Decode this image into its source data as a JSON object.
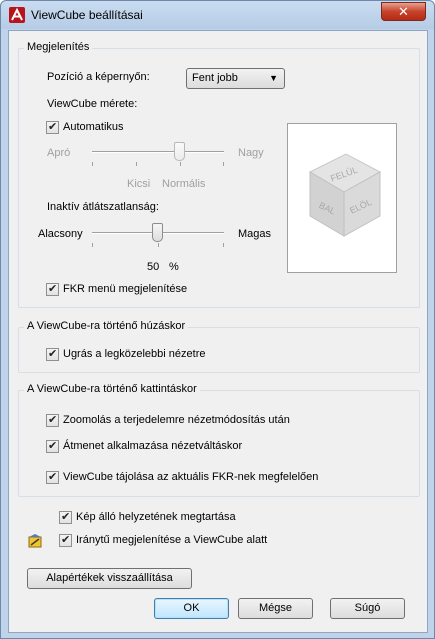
{
  "window": {
    "title": "ViewCube beállításai",
    "close_glyph": "✕"
  },
  "display": {
    "group_title": "Megjelenítés",
    "position_label": "Pozíció a képernyőn:",
    "position_value": "Fent jobb",
    "size_label": "ViewCube mérete:",
    "auto_label": "Automatikus",
    "auto_checked": true,
    "size_min_label": "Apró",
    "size_max_label": "Nagy",
    "size_tick_small": "Kicsi",
    "size_tick_normal": "Normális",
    "size_value": "Normális",
    "size_disabled": true,
    "opacity_label": "Inaktív átlátszatlanság:",
    "opacity_min_label": "Alacsony",
    "opacity_max_label": "Magas",
    "opacity_value": "50",
    "opacity_unit": "%",
    "fkr_label": "FKR menü megjelenítése",
    "fkr_checked": true
  },
  "cube_preview": {
    "face_top": "FELÜL",
    "face_left": "BAL",
    "face_right": "ELÖL"
  },
  "drag_group": {
    "group_title": "A ViewCube-ra történő húzáskor",
    "snap_label": "Ugrás a legközelebbi nézetre",
    "snap_checked": true
  },
  "click_group": {
    "group_title": "A ViewCube-ra történő kattintáskor",
    "zoom_label": "Zoomolás a terjedelemre nézetmódosítás után",
    "zoom_checked": true,
    "transition_label": "Átmenet alkalmazása nézetváltáskor",
    "transition_checked": true,
    "orient_label": "ViewCube tájolása az aktuális FKR-nek megfelelően",
    "orient_checked": true
  },
  "extras": {
    "upright_label": "Kép álló helyzetének megtartása",
    "upright_checked": true,
    "compass_label": "Iránytű megjelenítése a ViewCube alatt",
    "compass_checked": true
  },
  "buttons": {
    "restore_defaults": "Alapértékek visszaállítása",
    "ok": "OK",
    "cancel": "Mégse",
    "help": "Súgó"
  },
  "colors": {
    "title_bar": "#c9dcf0",
    "close_button": "#c7432b",
    "default_button": "#3c7fb1"
  }
}
